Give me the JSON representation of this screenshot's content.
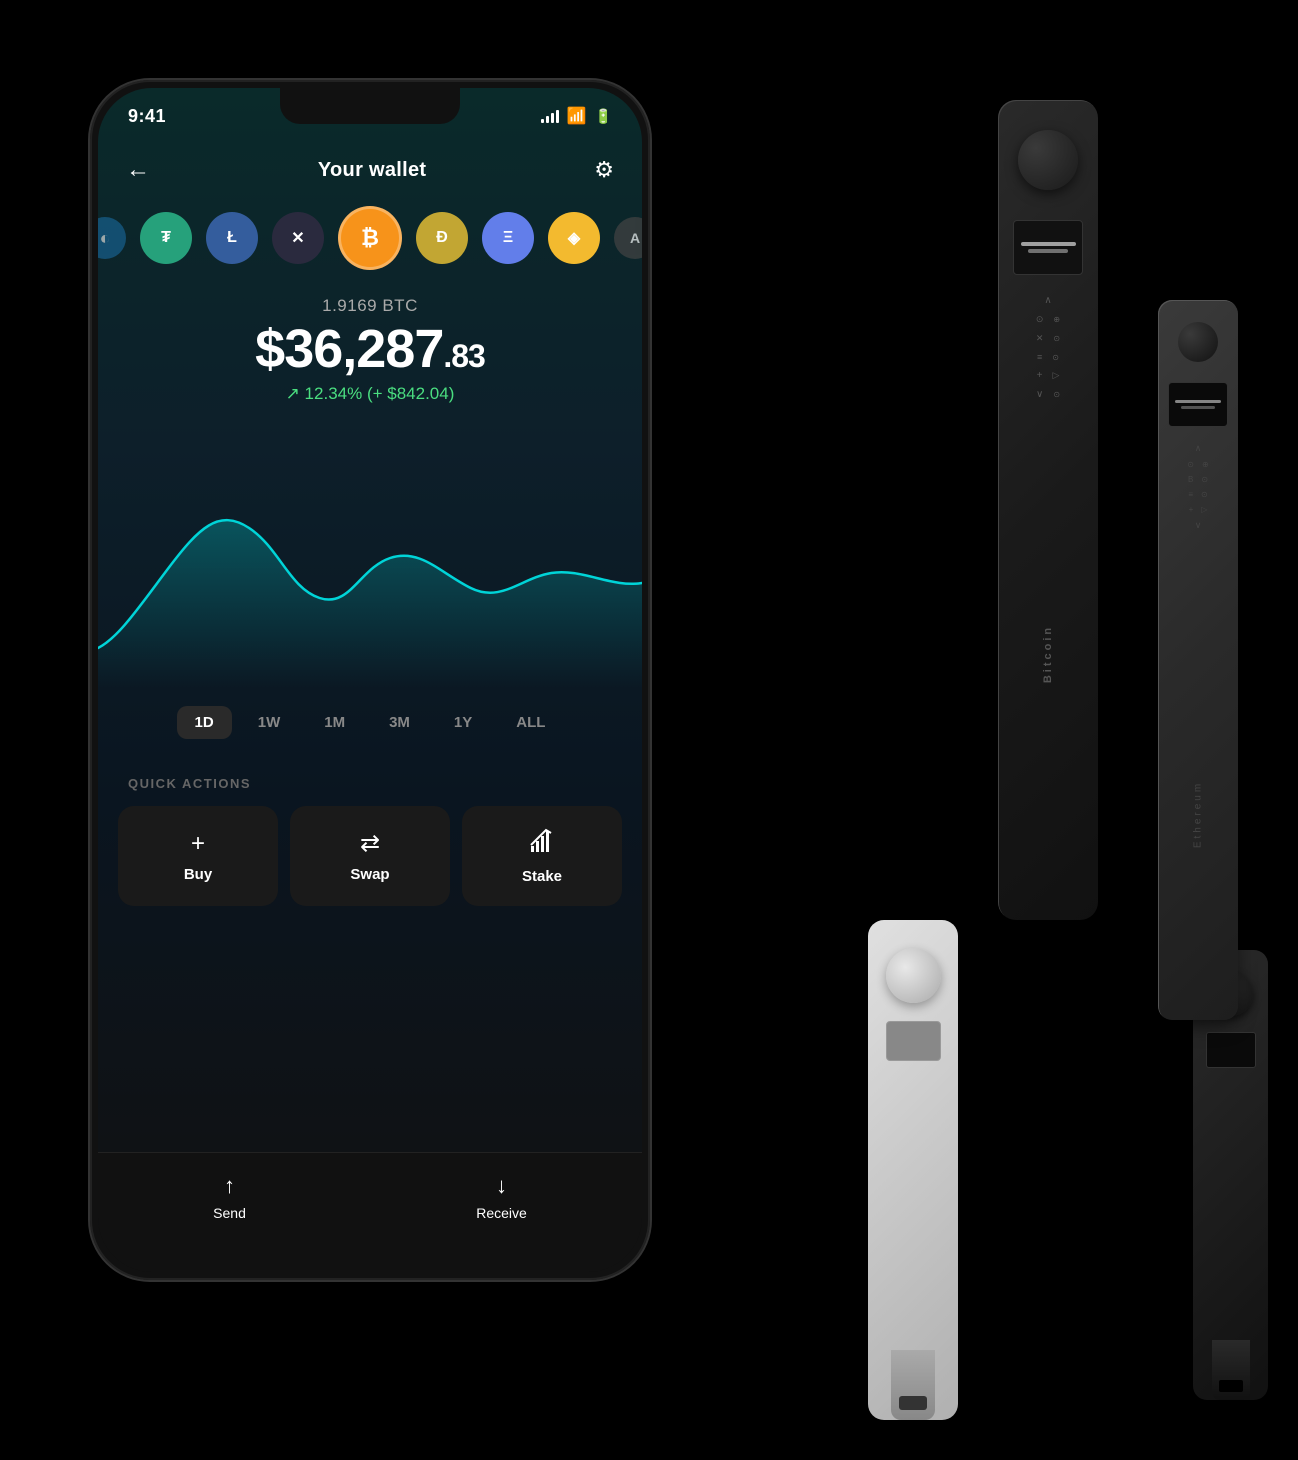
{
  "scene": {
    "background": "#000"
  },
  "status_bar": {
    "time": "9:41",
    "signal_label": "signal bars",
    "wifi_label": "wifi",
    "battery_label": "battery"
  },
  "header": {
    "back_label": "←",
    "title": "Your wallet",
    "settings_label": "⚙"
  },
  "crypto_icons": [
    {
      "id": "partial",
      "symbol": "",
      "bg": "#1a6ba0"
    },
    {
      "id": "tether",
      "symbol": "₮",
      "bg": "#26a17b"
    },
    {
      "id": "litecoin",
      "symbol": "Ł",
      "bg": "#345d9d"
    },
    {
      "id": "xrp",
      "symbol": "✕",
      "bg": "#1a1a2e"
    },
    {
      "id": "bitcoin",
      "symbol": "₿",
      "bg": "#f7931a"
    },
    {
      "id": "doge",
      "symbol": "Ð",
      "bg": "#c2a633"
    },
    {
      "id": "ethereum",
      "symbol": "Ξ",
      "bg": "#627eea"
    },
    {
      "id": "binance",
      "symbol": "◈",
      "bg": "#f3ba2f"
    },
    {
      "id": "algo",
      "symbol": "A",
      "bg": "#555"
    }
  ],
  "balance": {
    "crypto_amount": "1.9169 BTC",
    "usd_whole": "$36,287",
    "usd_cents": ".83",
    "change_percent": "↗ 12.34%",
    "change_usd": "(+ $842.04)"
  },
  "time_filters": [
    {
      "label": "1D",
      "active": true
    },
    {
      "label": "1W",
      "active": false
    },
    {
      "label": "1M",
      "active": false
    },
    {
      "label": "3M",
      "active": false
    },
    {
      "label": "1Y",
      "active": false
    },
    {
      "label": "ALL",
      "active": false
    }
  ],
  "quick_actions": {
    "section_label": "QUICK ACTIONS",
    "buttons": [
      {
        "id": "buy",
        "icon": "+",
        "label": "Buy"
      },
      {
        "id": "swap",
        "icon": "⇄",
        "label": "Swap"
      },
      {
        "id": "stake",
        "icon": "↑↑",
        "label": "Stake"
      }
    ]
  },
  "bottom_bar": {
    "send": {
      "icon": "↑",
      "label": "Send"
    },
    "receive": {
      "icon": "↓",
      "label": "Receive"
    }
  },
  "hardware": {
    "nano_x_label": "Bitcoin",
    "nano_s_label": "Ethereum"
  }
}
